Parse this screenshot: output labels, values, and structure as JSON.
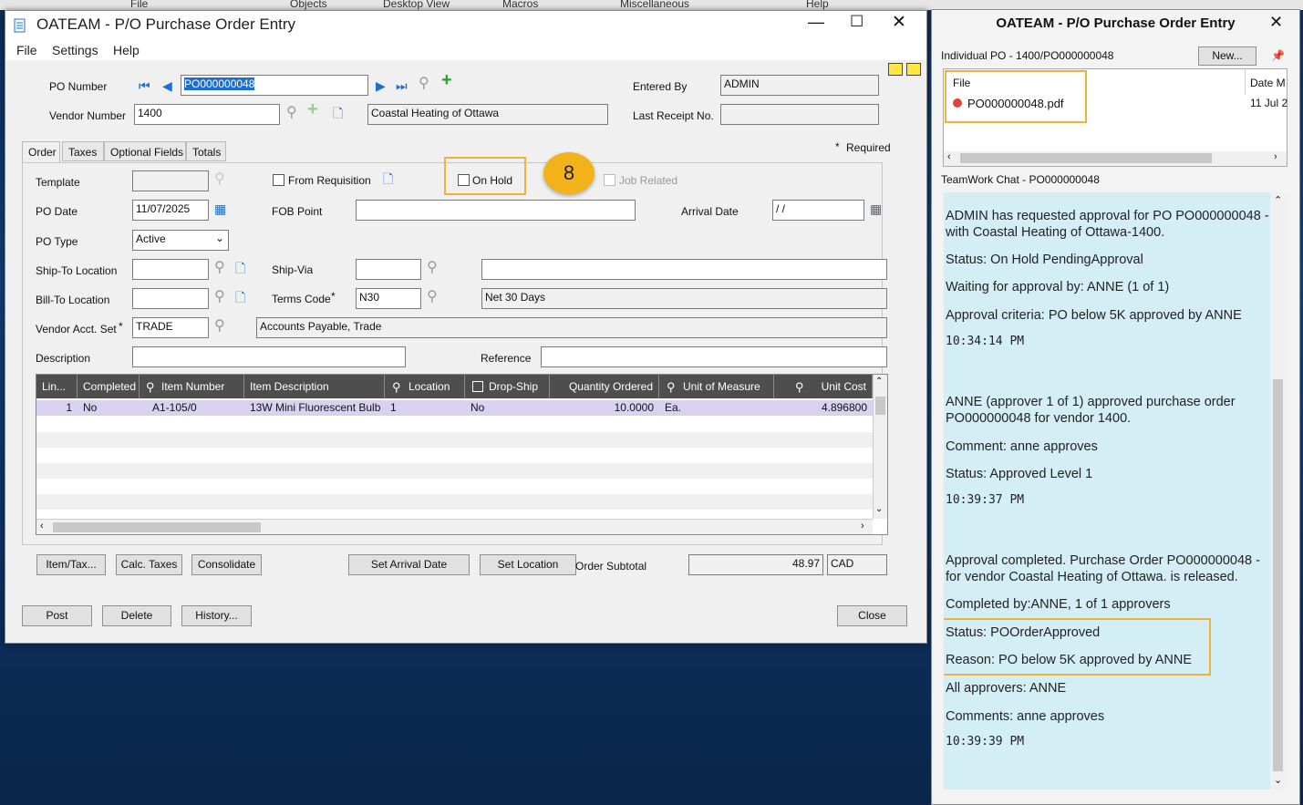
{
  "top_menu": [
    "File",
    "Objects",
    "Desktop View",
    "Macros",
    "Miscellaneous",
    "Help"
  ],
  "window": {
    "title": "OATEAM - P/O Purchase Order Entry",
    "menu": [
      "File",
      "Settings",
      "Help"
    ]
  },
  "header": {
    "po_number_label": "PO Number",
    "po_number": "PO000000048",
    "vendor_number_label": "Vendor Number",
    "vendor_number": "1400",
    "vendor_name": "Coastal Heating of Ottawa",
    "entered_by_label": "Entered By",
    "entered_by": "ADMIN",
    "last_receipt_label": "Last Receipt No.",
    "last_receipt": ""
  },
  "tabs": [
    "Order",
    "Taxes",
    "Optional Fields",
    "Totals"
  ],
  "required_note": "Required",
  "form": {
    "template_label": "Template",
    "from_requisition_label": "From Requisition",
    "on_hold_label": "On Hold",
    "job_related_label": "Job Related",
    "po_date_label": "PO Date",
    "po_date": "11/07/2025",
    "fob_point_label": "FOB Point",
    "arrival_date_label": "Arrival Date",
    "arrival_date": "/ /",
    "po_type_label": "PO Type",
    "po_type": "Active",
    "ship_to_label": "Ship-To Location",
    "ship_via_label": "Ship-Via",
    "bill_to_label": "Bill-To Location",
    "terms_code_label": "Terms Code",
    "terms_code": "N30",
    "terms_desc": "Net 30 Days",
    "vendor_acct_set_label": "Vendor Acct. Set",
    "vendor_acct_set": "TRADE",
    "vendor_acct_set_desc": "Accounts Payable, Trade",
    "description_label": "Description",
    "reference_label": "Reference"
  },
  "step_badge": "8",
  "grid": {
    "columns": [
      "Lin...",
      "Completed",
      "Item Number",
      "Item Description",
      "Location",
      "Drop-Ship",
      "Quantity Ordered",
      "Unit of Measure",
      "Unit Cost"
    ],
    "rows": [
      {
        "line": "1",
        "completed": "No",
        "item_number": "A1-105/0",
        "item_desc": "13W Mini Fluorescent Bulb",
        "location": "1",
        "drop_ship": "No",
        "qty": "10.0000",
        "uom": "Ea.",
        "unit_cost": "4.896800"
      }
    ]
  },
  "buttons": {
    "item_tax": "Item/Tax...",
    "calc_taxes": "Calc. Taxes",
    "consolidate": "Consolidate",
    "set_arrival": "Set Arrival Date",
    "set_location": "Set Location",
    "post": "Post",
    "delete": "Delete",
    "history": "History...",
    "close": "Close"
  },
  "totals": {
    "order_subtotal_label": "Order Subtotal",
    "order_subtotal": "48.97",
    "currency": "CAD"
  },
  "side": {
    "title": "OATEAM - P/O Purchase Order Entry",
    "individual_po": "Individual PO - 1400/PO000000048",
    "new_button": "New...",
    "file_col": "File",
    "date_col": "Date M",
    "file_name": "PO000000048.pdf",
    "file_date": "11 Jul 2",
    "chat_title": "TeamWork Chat - PO000000048",
    "chat": [
      "ADMIN has requested approval for PO PO000000048 - with Coastal Heating of Ottawa-1400.",
      "Status: On Hold PendingApproval",
      "Waiting for approval by: ANNE (1 of 1)",
      "Approval criteria: PO below 5K approved by ANNE",
      "10:34:14 PM",
      "ANNE (approver 1 of 1) approved purchase order PO000000048 for vendor 1400.",
      "Comment: anne approves",
      "Status: Approved Level 1",
      "10:39:37 PM",
      "Approval completed. Purchase Order PO000000048 - for vendor Coastal Heating of Ottawa.  is released.",
      "Completed by:ANNE, 1 of 1 approvers",
      "Status: POOrderApproved",
      "Reason: PO below 5K approved by ANNE",
      "All approvers: ANNE",
      "Comments: anne approves",
      "10:39:39 PM"
    ]
  }
}
